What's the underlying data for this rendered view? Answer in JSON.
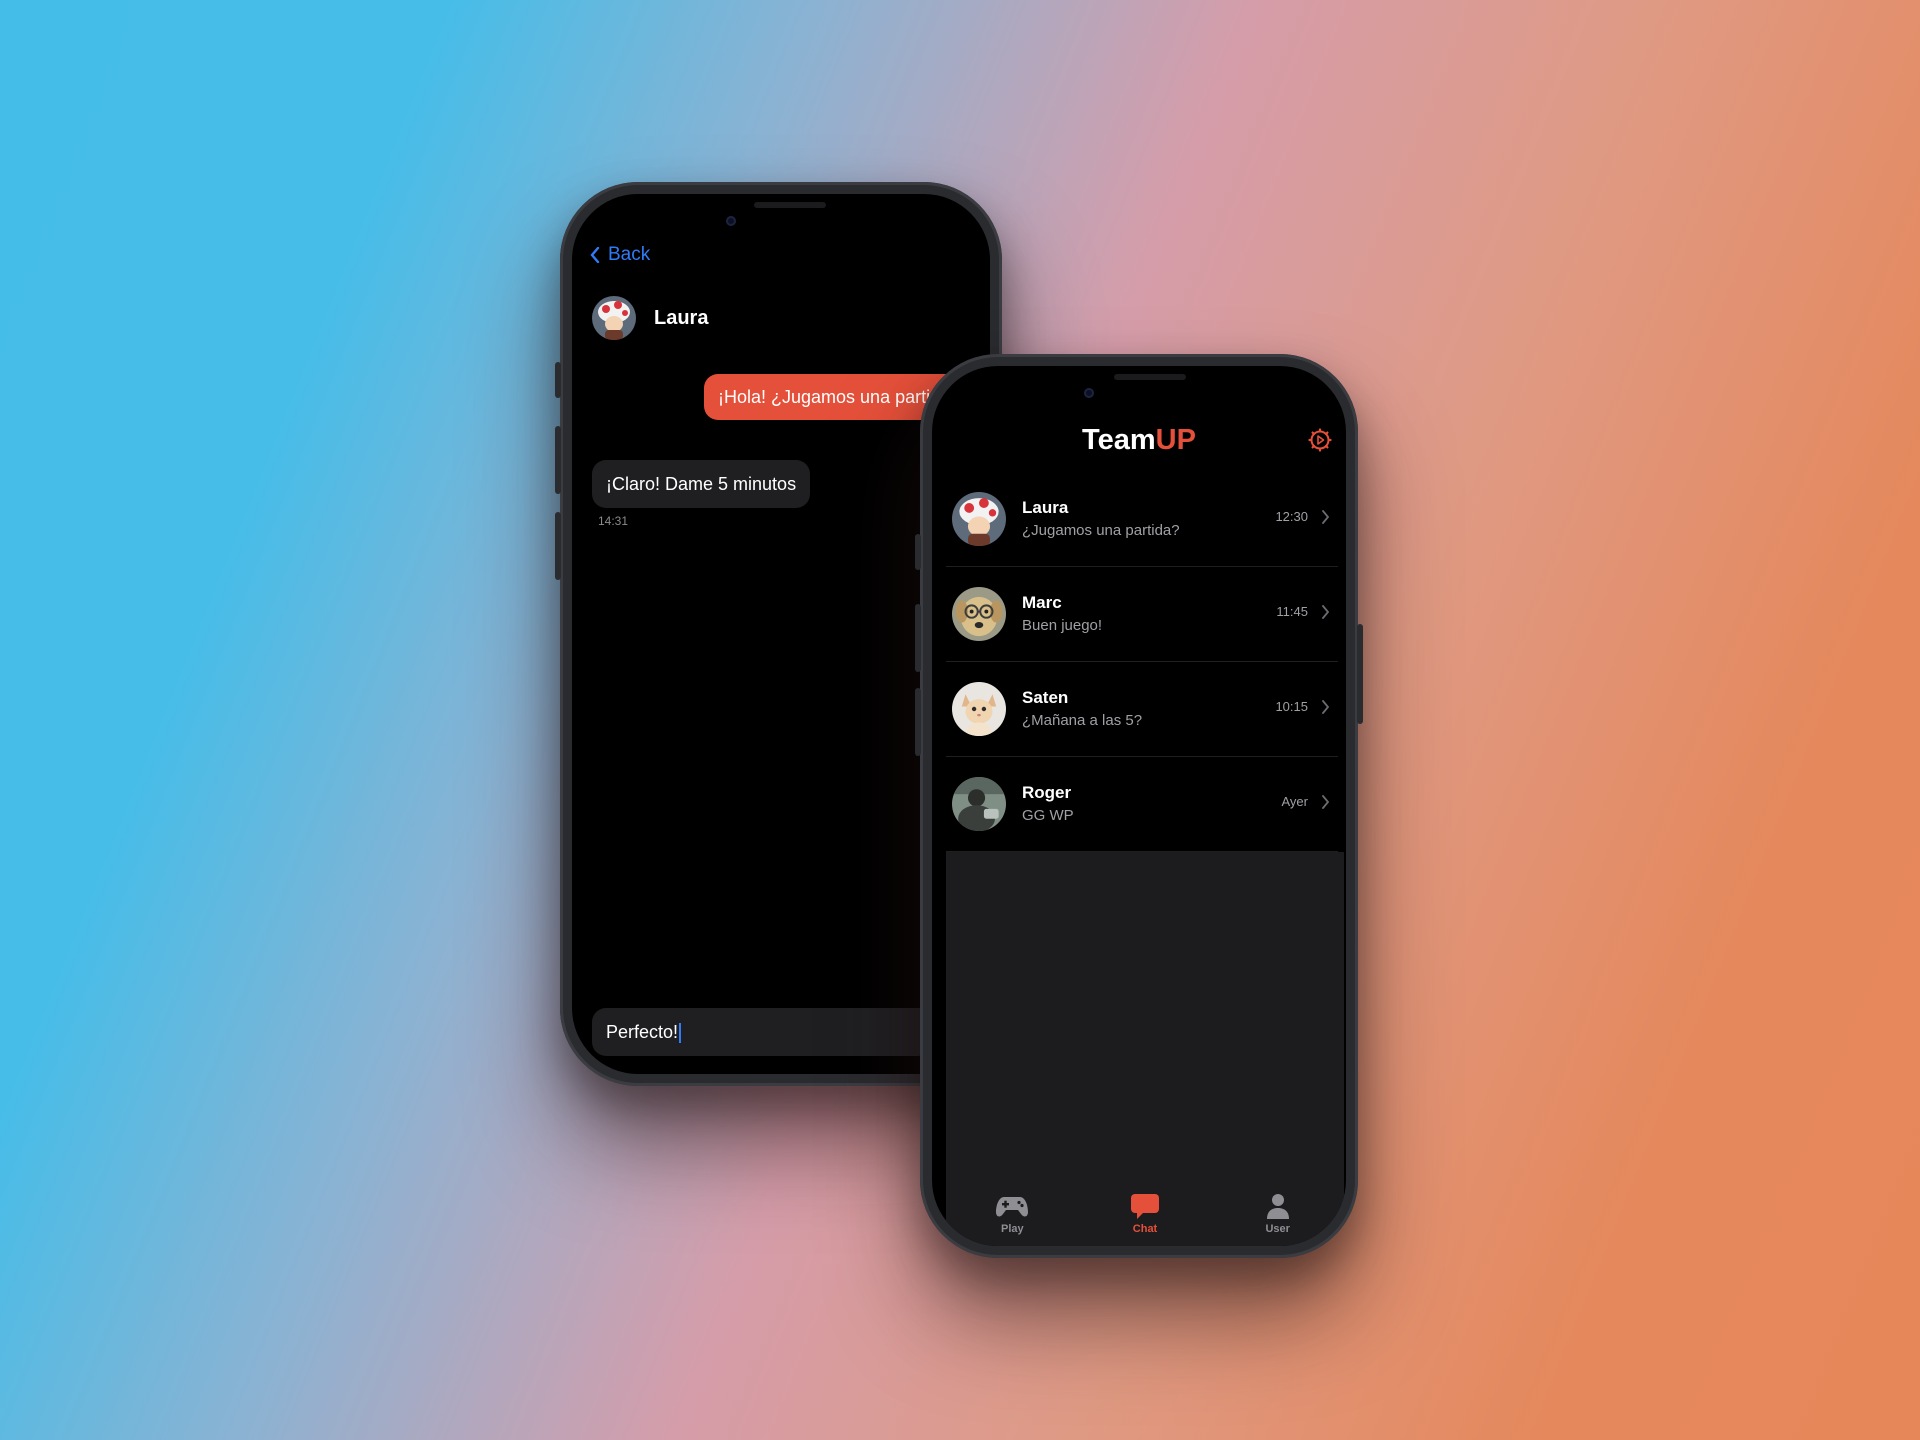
{
  "colors": {
    "accent": "#e5503a",
    "link": "#2f7cf6",
    "bubble_in": "#1f1f22"
  },
  "chat_screen": {
    "back_label": "Back",
    "contact_name": "Laura",
    "messages": [
      {
        "direction": "out",
        "text": "¡Hola! ¿Jugamos una partida?"
      },
      {
        "direction": "in",
        "text": "¡Claro! Dame 5 minutos",
        "time": "14:31"
      }
    ],
    "input_value": "Perfecto!"
  },
  "list_screen": {
    "title_part1": "Team",
    "title_part2": "UP",
    "settings_icon": "gear-icon",
    "conversations": [
      {
        "name": "Laura",
        "preview": "¿Jugamos una partida?",
        "time": "12:30",
        "avatar": "mushroom-character"
      },
      {
        "name": "Marc",
        "preview": "Buen juego!",
        "time": "11:45",
        "avatar": "dog-with-glasses"
      },
      {
        "name": "Saten",
        "preview": "¿Mañana a las 5?",
        "time": "10:15",
        "avatar": "kitten"
      },
      {
        "name": "Roger",
        "preview": "GG WP",
        "time": "Ayer",
        "avatar": "dark-figure"
      }
    ],
    "tabs": [
      {
        "label": "Play",
        "icon": "gamepad-icon",
        "active": false
      },
      {
        "label": "Chat",
        "icon": "chat-bubble-icon",
        "active": true
      },
      {
        "label": "User",
        "icon": "user-icon",
        "active": false
      }
    ]
  }
}
